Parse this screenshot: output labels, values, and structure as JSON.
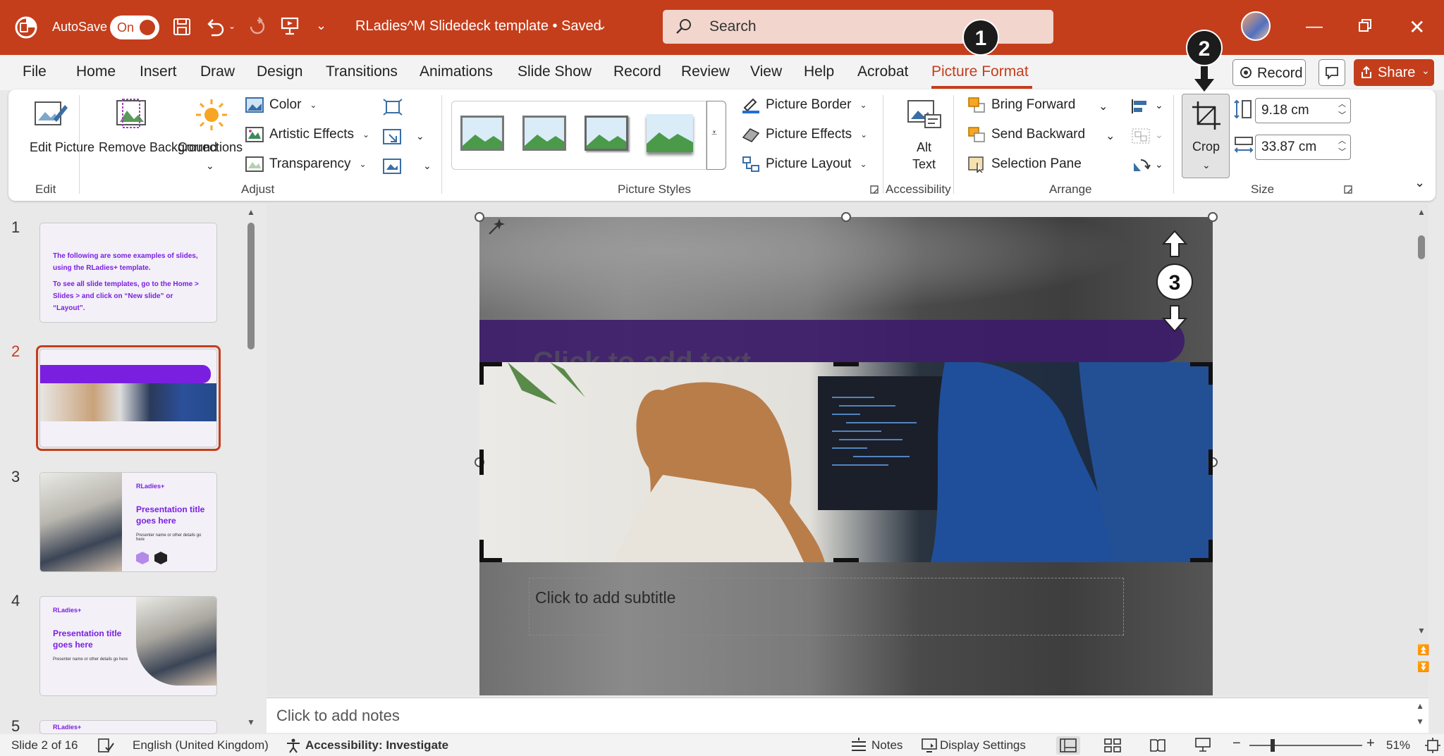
{
  "titlebar": {
    "autosave_label": "AutoSave",
    "autosave_state": "On",
    "document_title": "RLadies^M Slidedeck template • Saved",
    "search_placeholder": "Search"
  },
  "menu_tabs": [
    "File",
    "Home",
    "Insert",
    "Draw",
    "Design",
    "Transitions",
    "Animations",
    "Slide Show",
    "Record",
    "Review",
    "View",
    "Help",
    "Acrobat",
    "Picture Format"
  ],
  "active_tab": "Picture Format",
  "record_button": "Record",
  "share_button": "Share",
  "ribbon": {
    "edit": {
      "button": "Edit Picture",
      "group": "Edit"
    },
    "adjust": {
      "remove_background": "Remove Background",
      "corrections": "Corrections",
      "color": "Color",
      "artistic_effects": "Artistic Effects",
      "transparency": "Transparency",
      "group": "Adjust"
    },
    "picture_styles": {
      "picture_border": "Picture Border",
      "picture_effects": "Picture Effects",
      "picture_layout": "Picture Layout",
      "group": "Picture Styles"
    },
    "accessibility": {
      "alt_text": "Alt Text",
      "group": "Accessibility"
    },
    "arrange": {
      "bring_forward": "Bring Forward",
      "send_backward": "Send Backward",
      "selection_pane": "Selection Pane",
      "group": "Arrange"
    },
    "size": {
      "crop": "Crop",
      "height": "9.18 cm",
      "width": "33.87 cm",
      "group": "Size"
    }
  },
  "thumbnails": [
    {
      "num": "1",
      "line1": "The following are some examples of slides,",
      "line2": "using the RLadies+ template.",
      "line3": "To see all slide templates, go to the Home >",
      "line4": "Slides > and click on “New slide” or “Layout”."
    },
    {
      "num": "2"
    },
    {
      "num": "3",
      "brand": "RLadies+",
      "title": "Presentation title goes here",
      "sub": "Presenter name or other details go here"
    },
    {
      "num": "4",
      "brand": "RLadies+",
      "title": "Presentation title goes here",
      "sub": "Presenter name or other details go here"
    },
    {
      "num": "5",
      "brand": "RLadies+"
    }
  ],
  "selected_slide": 2,
  "slide": {
    "title_placeholder": "Click to add text",
    "subtitle_placeholder": "Click to add subtitle"
  },
  "notes_placeholder": "Click to add notes",
  "callouts": [
    "1",
    "2",
    "3"
  ],
  "statusbar": {
    "slide_info": "Slide 2 of 16",
    "language": "English (United Kingdom)",
    "accessibility": "Accessibility: Investigate",
    "notes": "Notes",
    "display_settings": "Display Settings",
    "zoom": "51%"
  },
  "colors": {
    "titlebar": "#c43e1c",
    "accent_purple": "#7a1fe0",
    "active_tab": "#c43e1c"
  }
}
